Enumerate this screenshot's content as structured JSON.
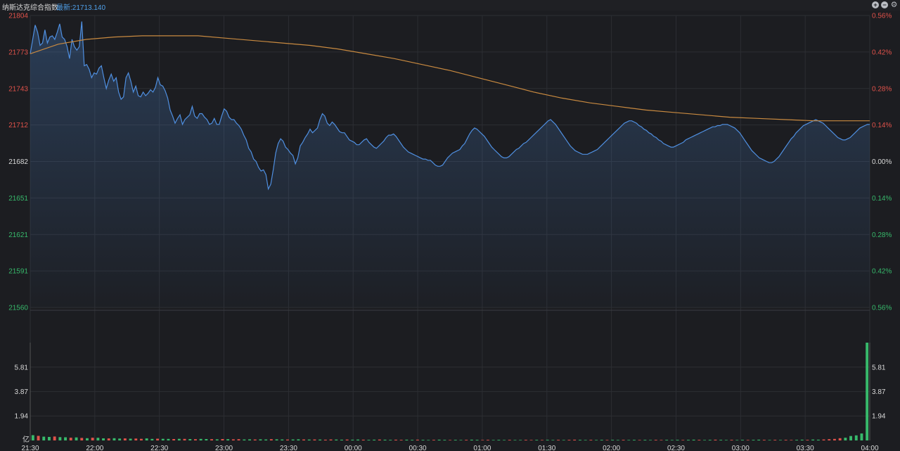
{
  "header": {
    "title": "纳斯达克综合指数",
    "latest": "最新:21713.140"
  },
  "controls": {
    "plus": "+",
    "minus": "−",
    "gear": "⚙"
  },
  "colors": {
    "background": "#1c1d21",
    "grid": "#2c2e33",
    "price_line": "#4f8fe0",
    "avg_line": "#c98a40",
    "up": "#e0524a",
    "down": "#37b96b",
    "neutral": "#d9d9d9"
  },
  "chart_data": {
    "type": "line",
    "title": "纳斯达克综合指数",
    "base_price": 21682,
    "price_axis": {
      "ticks": [
        "21804",
        "21773",
        "21743",
        "21712",
        "21682",
        "21651",
        "21621",
        "21591",
        "21560"
      ],
      "range": [
        21560,
        21804
      ]
    },
    "percent_axis": {
      "ticks": [
        "0.56%",
        "0.42%",
        "0.28%",
        "0.14%",
        "0.00%",
        "0.14%",
        "0.28%",
        "0.42%",
        "0.56%"
      ]
    },
    "x_ticks": [
      "21:30",
      "22:00",
      "22:30",
      "23:00",
      "23:30",
      "00:00",
      "00:30",
      "01:00",
      "01:30",
      "02:00",
      "02:30",
      "03:00",
      "03:30",
      "04:00"
    ],
    "volume_axis": {
      "unit": "亿",
      "ticks": [
        "5.81",
        "3.87",
        "1.94"
      ],
      "max": 7.75
    },
    "series": [
      {
        "values": [
          21772,
          21784,
          21796,
          21790,
          21779,
          21781,
          21792,
          21781,
          21786,
          21787,
          21784,
          21790,
          21797,
          21786,
          21784,
          21778,
          21768,
          21784,
          21778,
          21775,
          21778,
          21799,
          21762,
          21763,
          21759,
          21752,
          21756,
          21755,
          21760,
          21762,
          21752,
          21743,
          21750,
          21755,
          21749,
          21752,
          21740,
          21734,
          21736,
          21752,
          21756,
          21749,
          21740,
          21745,
          21737,
          21736,
          21740,
          21737,
          21739,
          21742,
          21740,
          21744,
          21752,
          21746,
          21745,
          21741,
          21735,
          21725,
          21720,
          21714,
          21718,
          21721,
          21713,
          21717,
          21719,
          21721,
          21728,
          21720,
          21718,
          21722,
          21722,
          21719,
          21717,
          21713,
          21714,
          21718,
          21713,
          21713,
          21720,
          21726,
          21724,
          21719,
          21717,
          21717,
          21714,
          21712,
          21709,
          21704,
          21700,
          21693,
          21690,
          21684,
          21682,
          21677,
          21674,
          21675,
          21671,
          21659,
          21663,
          21675,
          21689,
          21697,
          21701,
          21699,
          21694,
          21692,
          21689,
          21687,
          21680,
          21685,
          21695,
          21698,
          21702,
          21705,
          21709,
          21706,
          21708,
          21710,
          21717,
          21722,
          21720,
          21714,
          21712,
          21715,
          21713,
          21710,
          21707,
          21706,
          21706,
          21703,
          21700,
          21699,
          21698,
          21696,
          21696,
          21698,
          21700,
          21701,
          21698,
          21696,
          21694,
          21693,
          21695,
          21697,
          21699,
          21702,
          21704,
          21704,
          21705,
          21703,
          21700,
          21697,
          21694,
          21692,
          21690,
          21689,
          21688,
          21687,
          21686,
          21685,
          21684,
          21684,
          21683,
          21683,
          21681,
          21679,
          21678,
          21678,
          21679,
          21682,
          21685,
          21687,
          21689,
          21690,
          21691,
          21692,
          21695,
          21697,
          21701,
          21705,
          21708,
          21710,
          21709,
          21707,
          21705,
          21703,
          21700,
          21697,
          21694,
          21692,
          21690,
          21688,
          21686,
          21685,
          21685,
          21686,
          21688,
          21690,
          21692,
          21693,
          21695,
          21697,
          21698,
          21700,
          21702,
          21704,
          21706,
          21708,
          21710,
          21712,
          21714,
          21716,
          21717,
          21715,
          21713,
          21710,
          21707,
          21704,
          21701,
          21698,
          21695,
          21693,
          21691,
          21690,
          21689,
          21688,
          21688,
          21688,
          21689,
          21690,
          21691,
          21692,
          21694,
          21696,
          21698,
          21700,
          21702,
          21704,
          21706,
          21708,
          21710,
          21712,
          21714,
          21715,
          21716,
          21716,
          21715,
          21714,
          21712,
          21711,
          21709,
          21708,
          21706,
          21705,
          21703,
          21702,
          21700,
          21699,
          21697,
          21696,
          21695,
          21694,
          21694,
          21695,
          21696,
          21697,
          21698,
          21700,
          21701,
          21702,
          21703,
          21704,
          21705,
          21706,
          21707,
          21708,
          21709,
          21710,
          21711,
          21711,
          21712,
          21712,
          21713,
          21713,
          21713,
          21712,
          21711,
          21710,
          21708,
          21706,
          21703,
          21700,
          21697,
          21694,
          21691,
          21689,
          21687,
          21685,
          21684,
          21683,
          21682,
          21681,
          21681,
          21682,
          21684,
          21686,
          21689,
          21692,
          21695,
          21698,
          21701,
          21703,
          21706,
          21708,
          21710,
          21712,
          21713,
          21714,
          21715,
          21716,
          21717,
          21716,
          21715,
          21714,
          21712,
          21710,
          21708,
          21706,
          21704,
          21702,
          21701,
          21700,
          21700,
          21701,
          21702,
          21704,
          21706,
          21708,
          21710,
          21711,
          21712,
          21713,
          21713
        ]
      },
      {
        "name": "avg",
        "values": [
          21772,
          21780,
          21784,
          21786,
          21787,
          21787,
          21787,
          21785,
          21783,
          21781,
          21779,
          21776,
          21772,
          21768,
          21763,
          21758,
          21752,
          21746,
          21740,
          21735,
          21731,
          21728,
          21725,
          21723,
          21721,
          21719,
          21718,
          21717,
          21716,
          21716,
          21716
        ]
      }
    ],
    "volume": {
      "values": [
        0.42,
        0.36,
        0.3,
        0.28,
        0.31,
        0.26,
        0.25,
        0.22,
        0.24,
        0.2,
        0.18,
        0.22,
        0.21,
        0.17,
        0.16,
        0.18,
        0.15,
        0.16,
        0.14,
        0.15,
        0.13,
        0.16,
        0.12,
        0.14,
        0.13,
        0.12,
        0.11,
        0.13,
        0.12,
        0.11,
        0.1,
        0.12,
        0.11,
        0.1,
        0.09,
        0.11,
        0.1,
        0.09,
        0.1,
        0.08,
        0.09,
        0.08,
        0.09,
        0.08,
        0.1,
        0.09,
        0.08,
        0.07,
        0.08,
        0.09,
        0.08,
        0.07,
        0.08,
        0.07,
        0.06,
        0.08,
        0.07,
        0.06,
        0.07,
        0.06,
        0.07,
        0.06,
        0.05,
        0.06,
        0.07,
        0.06,
        0.05,
        0.06,
        0.05,
        0.06,
        0.05,
        0.06,
        0.05,
        0.04,
        0.05,
        0.06,
        0.05,
        0.04,
        0.05,
        0.04,
        0.05,
        0.06,
        0.05,
        0.04,
        0.05,
        0.04,
        0.05,
        0.04,
        0.05,
        0.04,
        0.04,
        0.05,
        0.04,
        0.05,
        0.04,
        0.05,
        0.04,
        0.05,
        0.04,
        0.05,
        0.06,
        0.05,
        0.04,
        0.05,
        0.04,
        0.05,
        0.04,
        0.05,
        0.04,
        0.05,
        0.04,
        0.05,
        0.04,
        0.05,
        0.04,
        0.05,
        0.04,
        0.05,
        0.04,
        0.05,
        0.04,
        0.05,
        0.06,
        0.05,
        0.04,
        0.05,
        0.06,
        0.05,
        0.04,
        0.05,
        0.04,
        0.05,
        0.04,
        0.05,
        0.06,
        0.05,
        0.04,
        0.05,
        0.04,
        0.05,
        0.04,
        0.05,
        0.06,
        0.05,
        0.07,
        0.06,
        0.08,
        0.1,
        0.12,
        0.18,
        0.22,
        0.35,
        0.4,
        0.55,
        7.75
      ],
      "directions": "dudduddudududdudduduudduddudududdududuudduddudduddududuuddudduddudduudduddudduddudduudddudduududduduudduddudduddudduuddduddudduddudduddududuuddudduuuu"
    }
  }
}
